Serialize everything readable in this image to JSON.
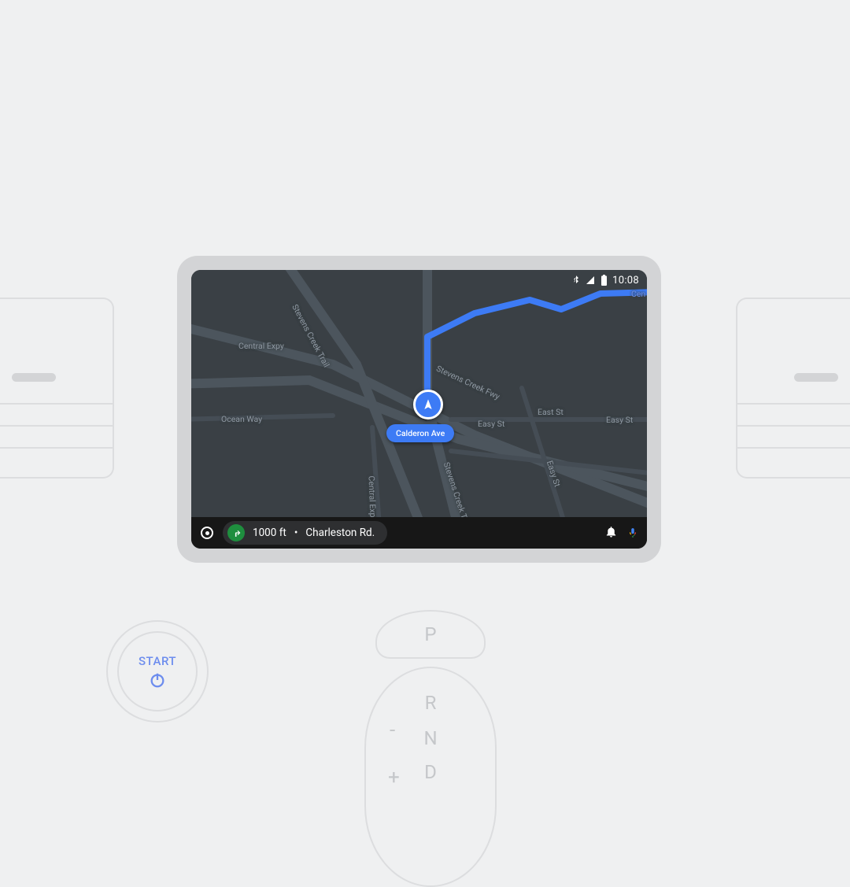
{
  "status_bar": {
    "clock": "10:08",
    "bluetooth_icon": "bluetooth-icon",
    "signal_icon": "signal-icon",
    "battery_icon": "battery-icon"
  },
  "map": {
    "current_street": "Calderon Ave",
    "road_labels": {
      "central_expy_top": "Central Expy",
      "central_expy_vert": "Central Expy",
      "stevens_creek_trail_top": "Stevens Creek Trail",
      "stevens_creek_trail_bot": "Stevens Creek Tr",
      "stevens_creek_fwy": "Stevens Creek Fwy",
      "ocean_way": "Ocean Way",
      "easy_st_1": "Easy St",
      "easy_st_2": "Easy St",
      "easy_st_3": "Easy St",
      "east_st": "East St",
      "cen": "Cen"
    }
  },
  "navigation": {
    "distance": "1000 ft",
    "separator": " • ",
    "street": "Charleston Rd."
  },
  "start_button": {
    "label": "START"
  },
  "shifter": {
    "park": "P",
    "reverse": "R",
    "neutral": "N",
    "drive": "D",
    "minus": "-",
    "plus": "+"
  }
}
